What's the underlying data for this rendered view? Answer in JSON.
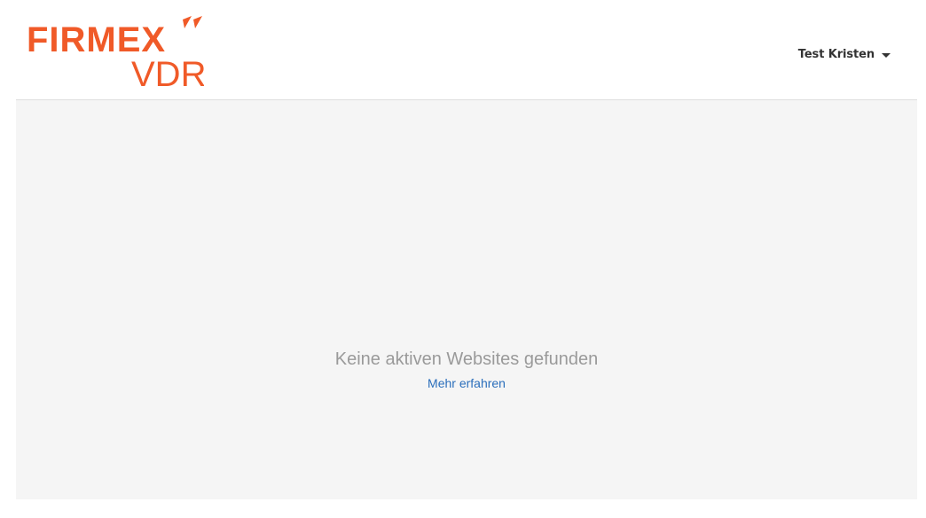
{
  "brand": {
    "name": "FIRMEX",
    "product": "VDR",
    "color": "#f05a28"
  },
  "header": {
    "user_name": "Test Kristen"
  },
  "main": {
    "empty_message": "Keine aktiven Websites gefunden",
    "learn_more": "Mehr erfahren"
  },
  "colors": {
    "link": "#2a6ebb",
    "muted_text": "#9a9a9a",
    "content_bg": "#f5f5f5"
  }
}
